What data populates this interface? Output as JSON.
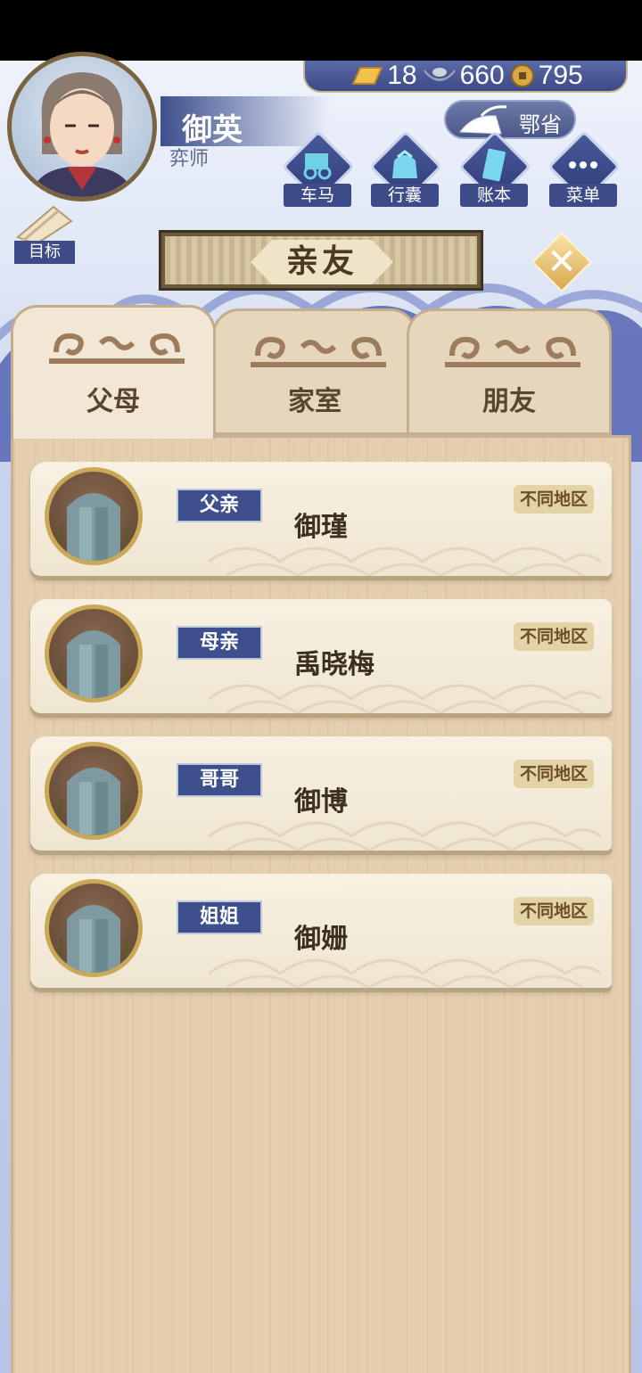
{
  "currency": {
    "gold": "18",
    "silver": "660",
    "coins": "795"
  },
  "player": {
    "name": "御英",
    "title": "弈师"
  },
  "region": {
    "label": "鄂省"
  },
  "menu": [
    {
      "label": "车马",
      "icon": "carriage-icon"
    },
    {
      "label": "行囊",
      "icon": "bag-icon"
    },
    {
      "label": "账本",
      "icon": "ledger-icon"
    },
    {
      "label": "菜单",
      "icon": "more-icon"
    }
  ],
  "goal": {
    "label": "目标"
  },
  "dialog": {
    "title": "亲友"
  },
  "tabs": [
    {
      "label": "父母",
      "active": true
    },
    {
      "label": "家室",
      "active": false
    },
    {
      "label": "朋友",
      "active": false
    }
  ],
  "relatives": [
    {
      "relation": "父亲",
      "name": "御瑾",
      "status": "不同地区"
    },
    {
      "relation": "母亲",
      "name": "禹晓梅",
      "status": "不同地区"
    },
    {
      "relation": "哥哥",
      "name": "御博",
      "status": "不同地区"
    },
    {
      "relation": "姐姐",
      "name": "御姗",
      "status": "不同地区"
    }
  ]
}
